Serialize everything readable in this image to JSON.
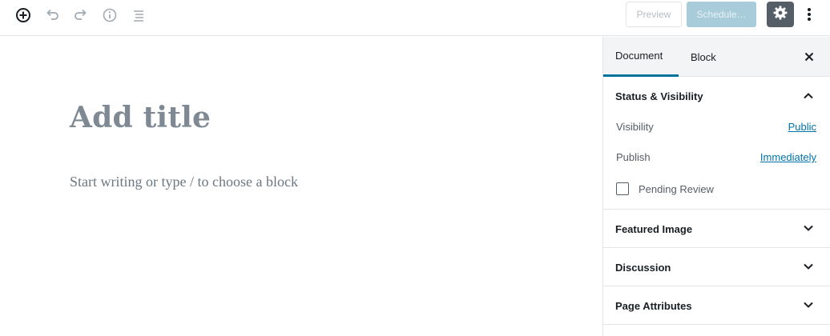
{
  "toolbar": {
    "icons": [
      "add-block-icon",
      "undo-icon",
      "redo-icon",
      "info-icon",
      "outline-icon",
      "gear-icon",
      "more-vertical-icon"
    ],
    "preview_label": "Preview",
    "schedule_label": "Schedule…"
  },
  "editor": {
    "title_placeholder": "Add title",
    "block_placeholder": "Start writing or type / to choose a block"
  },
  "sidebar": {
    "tabs": [
      {
        "label": "Document",
        "active": true
      },
      {
        "label": "Block",
        "active": false
      }
    ],
    "close_icon": "close-icon",
    "panels": [
      {
        "title": "Status & Visibility",
        "expanded": true,
        "rows": [
          {
            "label": "Visibility",
            "value": "Public"
          },
          {
            "label": "Publish",
            "value": "Immediately"
          }
        ],
        "checkbox": {
          "label": "Pending Review",
          "checked": false
        }
      },
      {
        "title": "Featured Image",
        "expanded": false
      },
      {
        "title": "Discussion",
        "expanded": false
      },
      {
        "title": "Page Attributes",
        "expanded": false
      }
    ]
  },
  "colors": {
    "accent": "#00739c",
    "link": "#0073aa",
    "schedule_button": "#a8ccd9",
    "settings_button": "#555d66"
  }
}
